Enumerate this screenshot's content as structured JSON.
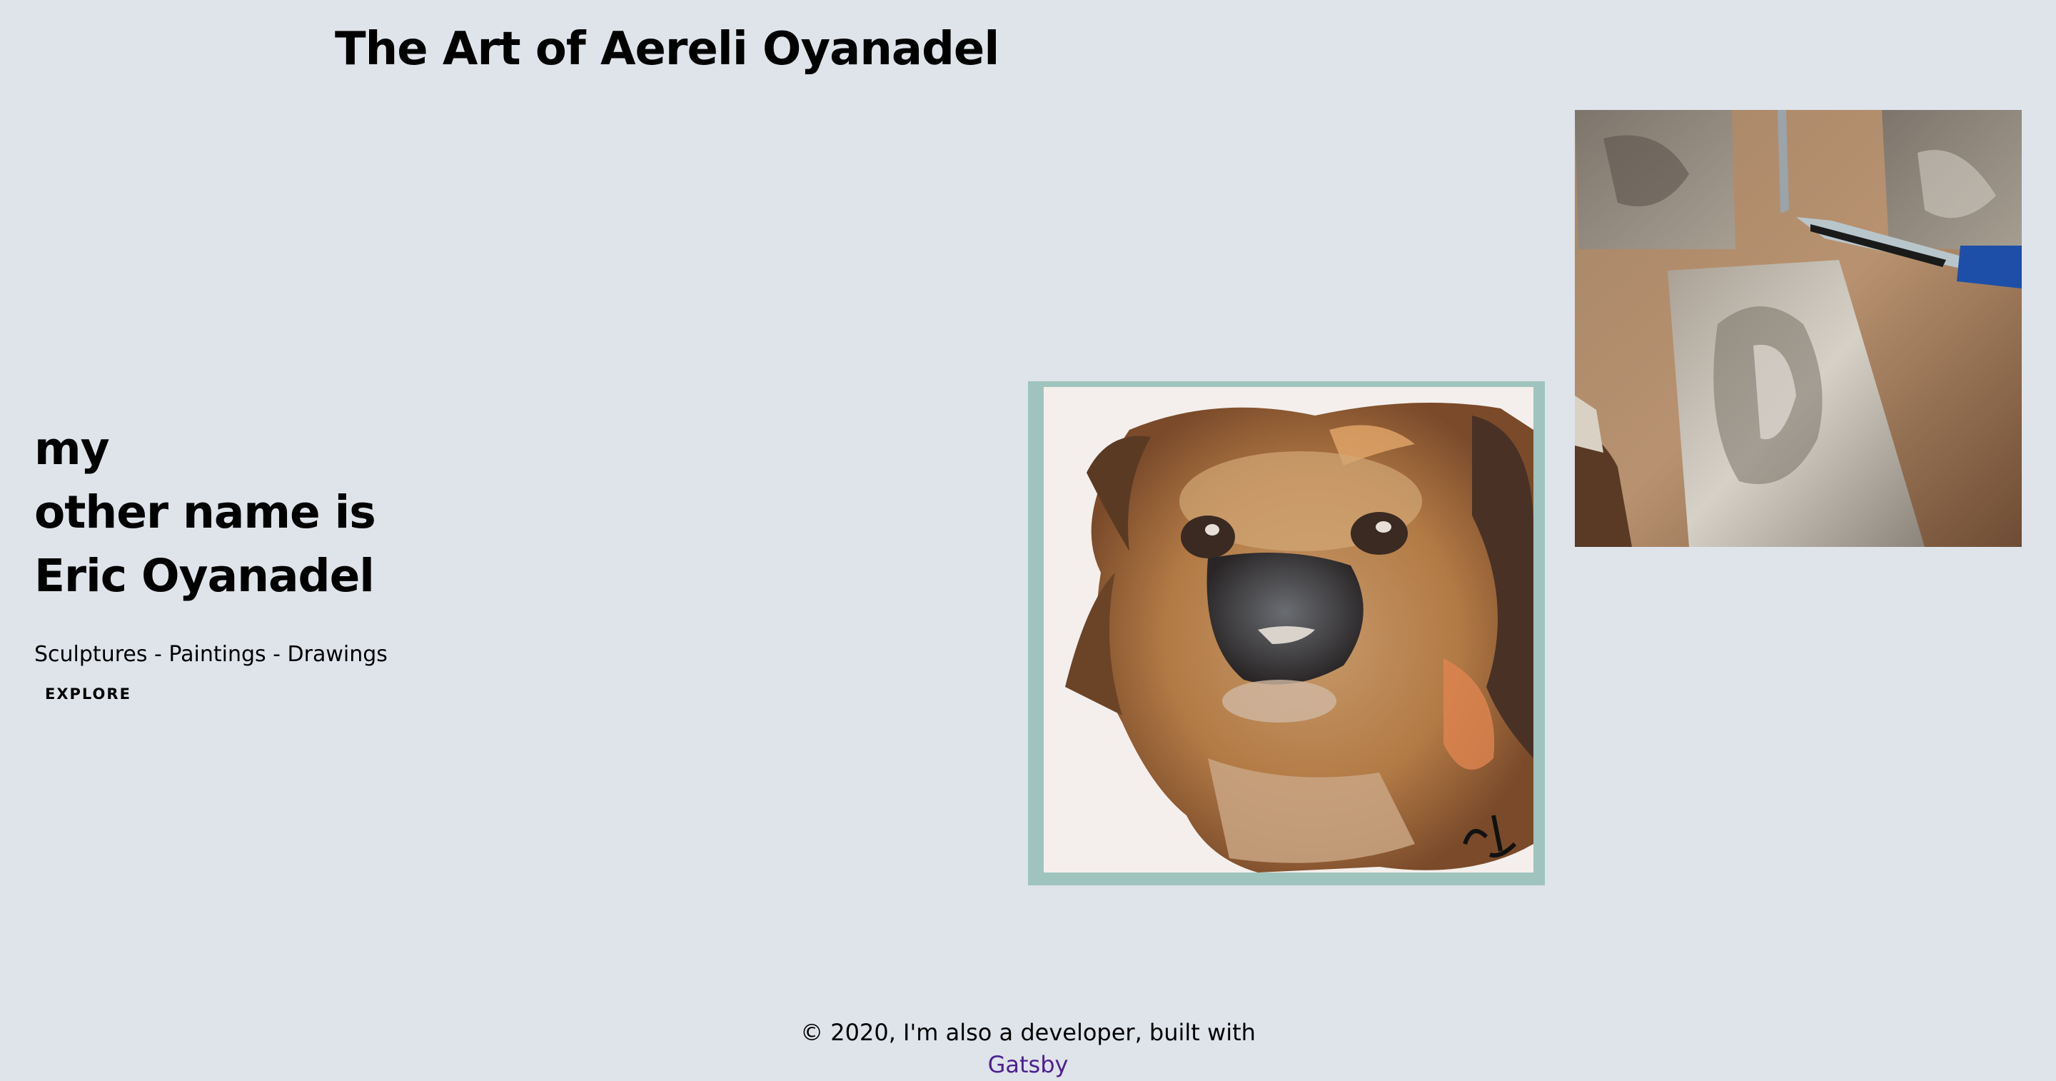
{
  "site": {
    "title": "The Art of Aereli Oyanadel"
  },
  "hero": {
    "heading_lines": [
      "my",
      "other name is",
      "Eric Oyanadel"
    ],
    "tagline": "Sculptures - Paintings - Drawings",
    "cta_label": "EXPLORE"
  },
  "gallery": {
    "images": [
      {
        "alt": "",
        "name": "dog-painting"
      },
      {
        "alt": "",
        "name": "metal-relief-photo"
      }
    ]
  },
  "footer": {
    "text": "© 2020, I'm also a developer, built with",
    "link_label": "Gatsby"
  },
  "colors": {
    "background": "#dfe3ea",
    "link": "#4b2190",
    "text": "#000000"
  }
}
